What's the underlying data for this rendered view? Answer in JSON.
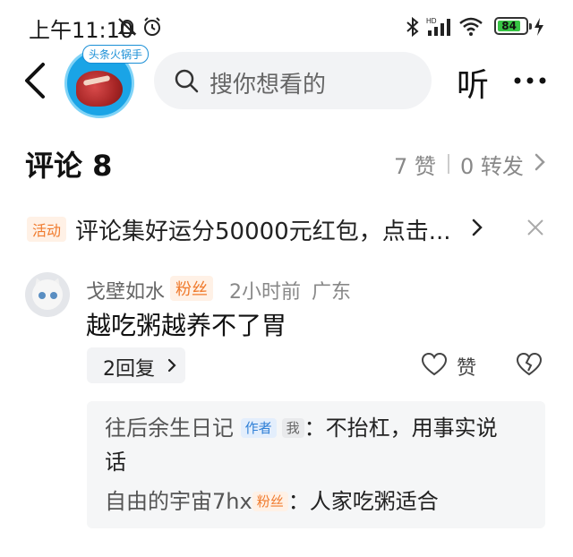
{
  "status_bar": {
    "time": "上午11:10",
    "battery": "84"
  },
  "header": {
    "account_badge": "头条火锅手",
    "search_placeholder": "搜你想看的",
    "listen_label": "听"
  },
  "comments_header": {
    "title": "评论 8",
    "likes": "7 赞",
    "shares": "0 转发"
  },
  "activity": {
    "badge": "活动",
    "text": "评论集好运分50000元红包，点击..."
  },
  "comment": {
    "username": "戈壁如水",
    "fan_badge": "粉丝",
    "time": "2小时前",
    "location": "广东",
    "body": "越吃粥越养不了胃",
    "reply_count_label": "2回复",
    "like_label": "赞",
    "replies": [
      {
        "user": "往后余生日记",
        "author_badge": "作者",
        "me_badge": "我",
        "text_line1": "：不抬杠，用事实说",
        "text_line2": "话"
      },
      {
        "user": "自由的宇宙7hx",
        "fan_badge": "粉丝",
        "text": "：人家吃粥适合"
      }
    ]
  },
  "colors": {
    "accent_orange": "#f07a2c",
    "author_blue": "#2f7fd6",
    "battery_green": "#37c443"
  }
}
